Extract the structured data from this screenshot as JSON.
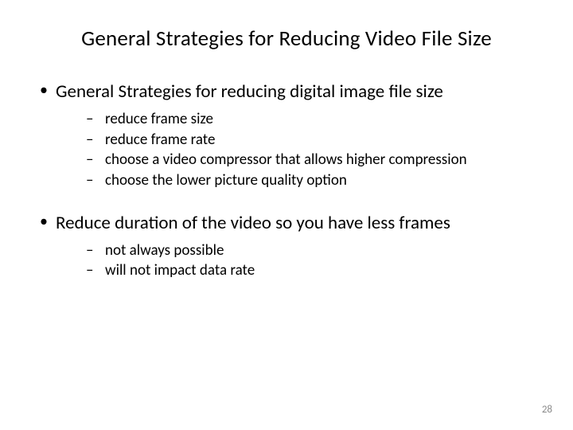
{
  "title": "General Strategies for Reducing Video File Size",
  "bullets": [
    {
      "text": "General Strategies for reducing digital image file size",
      "sub": [
        "reduce frame size",
        "reduce frame rate",
        "choose a video compressor that allows higher compression",
        "choose the lower picture quality option"
      ]
    },
    {
      "text": "Reduce duration of the video so you have less frames",
      "sub": [
        "not always possible",
        "will not impact data rate"
      ]
    }
  ],
  "page_number": "28"
}
